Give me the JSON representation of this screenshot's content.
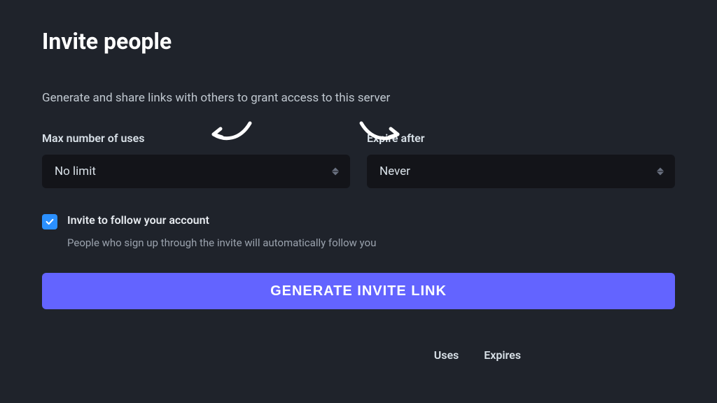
{
  "header": {
    "title": "Invite people",
    "description": "Generate and share links with others to grant access to this server"
  },
  "form": {
    "maxUses": {
      "label": "Max number of uses",
      "value": "No limit"
    },
    "expireAfter": {
      "label": "Expire after",
      "value": "Never"
    },
    "followCheckbox": {
      "checked": true,
      "label": "Invite to follow your account",
      "description": "People who sign up through the invite will automatically follow you"
    },
    "submitLabel": "GENERATE INVITE LINK"
  },
  "table": {
    "headers": {
      "uses": "Uses",
      "expires": "Expires"
    }
  }
}
